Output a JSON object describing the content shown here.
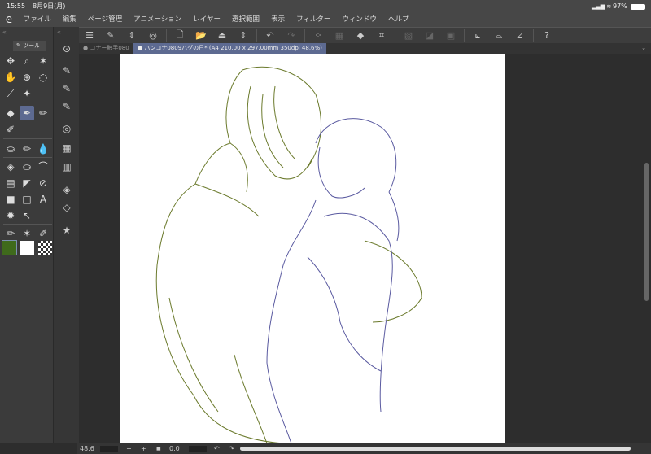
{
  "status": {
    "time": "15:55",
    "date": "8月9日(月)",
    "battery": "97%"
  },
  "menu": [
    "ファイル",
    "編集",
    "ページ管理",
    "アニメーション",
    "レイヤー",
    "選択範囲",
    "表示",
    "フィルター",
    "ウィンドウ",
    "ヘルプ"
  ],
  "tabs": [
    {
      "label": "● コナー触手080",
      "active": false
    },
    {
      "label": "● ハンコナ0809ハグの日* (A4 210.00 x 297.00mm 350dpi 48.6%)",
      "active": true
    }
  ],
  "tool_panel": {
    "title": "ツール"
  },
  "colors": {
    "main": "#3f6a1c",
    "sub": "#ffffff",
    "accent": "#5d6a91",
    "green_line": "#6b7a2c",
    "purple_line": "#5a5aa0"
  },
  "bottom": {
    "zoom": "48.6",
    "rotation": "0.0",
    "minus": "−",
    "plus": "+"
  }
}
